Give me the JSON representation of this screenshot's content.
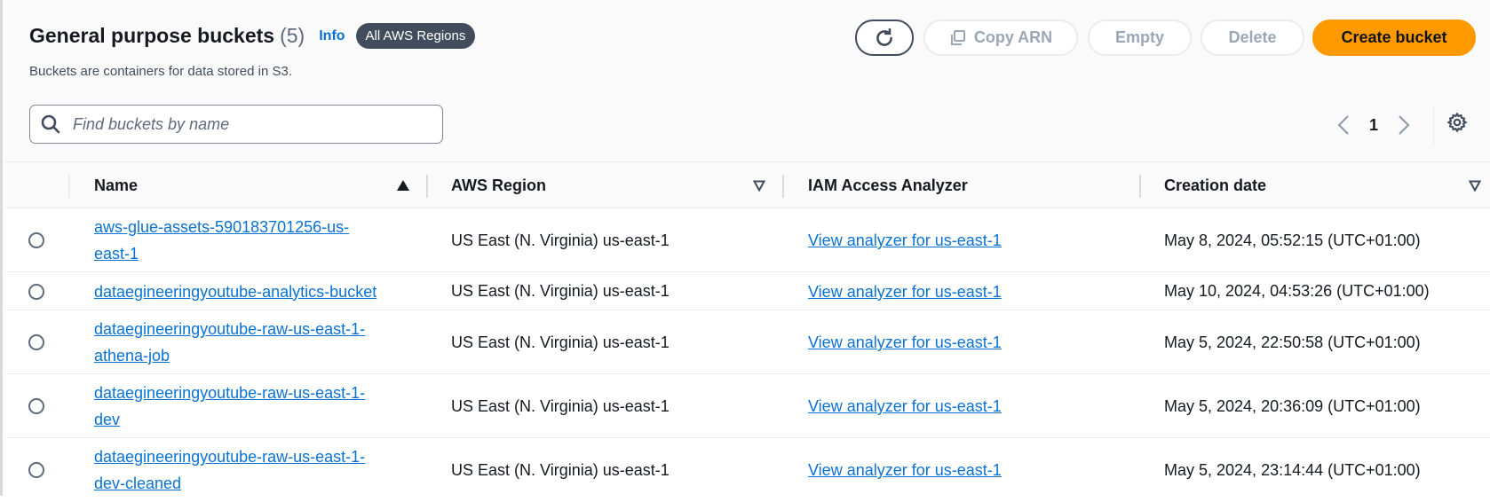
{
  "header": {
    "title": "General purpose buckets",
    "count": "(5)",
    "info": "Info",
    "region_badge": "All AWS Regions",
    "subtitle": "Buckets are containers for data stored in S3."
  },
  "toolbar": {
    "refresh_icon": "refresh-icon",
    "copy_icon": "copy-icon",
    "copy_arn": "Copy ARN",
    "empty": "Empty",
    "delete": "Delete",
    "create": "Create bucket"
  },
  "search": {
    "placeholder": "Find buckets by name",
    "value": ""
  },
  "pagination": {
    "page": "1"
  },
  "columns": {
    "name": "Name",
    "region": "AWS Region",
    "analyzer": "IAM Access Analyzer",
    "created": "Creation date"
  },
  "rows": [
    {
      "name_lines": [
        "aws-glue-assets-590183701256-us-",
        "east-1"
      ],
      "region": "US East (N. Virginia) us-east-1",
      "analyzer": "View analyzer for us-east-1",
      "created": "May 8, 2024, 05:52:15 (UTC+01:00)"
    },
    {
      "name_lines": [
        "dataegineeringyoutube-analytics-bucket"
      ],
      "region": "US East (N. Virginia) us-east-1",
      "analyzer": "View analyzer for us-east-1",
      "created": "May 10, 2024, 04:53:26 (UTC+01:00)"
    },
    {
      "name_lines": [
        "dataegineeringyoutube-raw-us-east-1-",
        "athena-job"
      ],
      "region": "US East (N. Virginia) us-east-1",
      "analyzer": "View analyzer for us-east-1",
      "created": "May 5, 2024, 22:50:58 (UTC+01:00)"
    },
    {
      "name_lines": [
        "dataegineeringyoutube-raw-us-east-1-",
        "dev"
      ],
      "region": "US East (N. Virginia) us-east-1",
      "analyzer": "View analyzer for us-east-1",
      "created": "May 5, 2024, 20:36:09 (UTC+01:00)"
    },
    {
      "name_lines": [
        "dataegineeringyoutube-raw-us-east-1-",
        "dev-cleaned"
      ],
      "region": "US East (N. Virginia) us-east-1",
      "analyzer": "View analyzer for us-east-1",
      "created": "May 5, 2024, 23:14:44 (UTC+01:00)"
    }
  ],
  "colors": {
    "primary": "#ff9900",
    "link": "#0972d3",
    "badge": "#414d5c"
  }
}
